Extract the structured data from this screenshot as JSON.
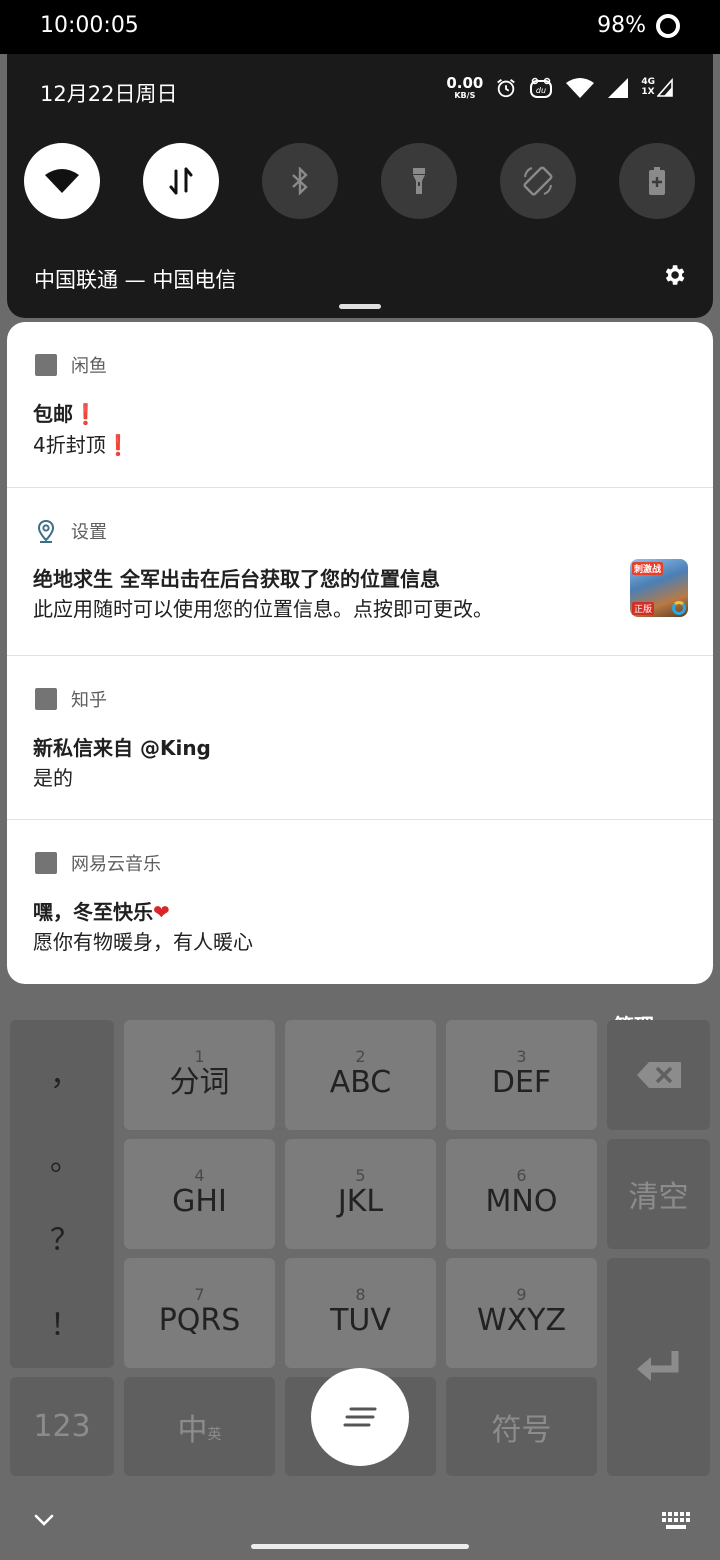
{
  "status_bar": {
    "time": "10:00:05",
    "battery": "98%"
  },
  "quick_settings": {
    "date": "12月22日周日",
    "speed_value": "0.00",
    "speed_unit": "KB/S",
    "net_type": "4G",
    "net_sub": "1X",
    "carrier": "中国联通 — 中国电信",
    "tiles": [
      {
        "name": "wifi",
        "active": true
      },
      {
        "name": "mobile-data",
        "active": true
      },
      {
        "name": "bluetooth",
        "active": false
      },
      {
        "name": "flashlight",
        "active": false
      },
      {
        "name": "auto-rotate",
        "active": false
      },
      {
        "name": "battery-saver",
        "active": false
      }
    ]
  },
  "notifications": [
    {
      "app": "闲鱼",
      "title": "包邮",
      "body": "4折封顶",
      "title_suffix": "❗",
      "body_suffix": "❗"
    },
    {
      "app": "设置",
      "title": "绝地求生 全军出击在后台获取了您的位置信息",
      "body": "此应用随时可以使用您的位置信息。点按即可更改。",
      "thumb_tag": "刺激战",
      "thumb_badge": "正版"
    },
    {
      "app": "知乎",
      "title": "新私信来自 @King",
      "body": "是的"
    },
    {
      "app": "网易云音乐",
      "title": "嘿，冬至快乐",
      "title_suffix": "❤",
      "body": "愿你有物暖身，有人暖心"
    }
  ],
  "keyboard": {
    "manage": "管理",
    "punctuation": [
      "，",
      "。",
      "？",
      "！"
    ],
    "keys": [
      {
        "num": "1",
        "label": "分词"
      },
      {
        "num": "2",
        "label": "ABC"
      },
      {
        "num": "3",
        "label": "DEF"
      },
      {
        "num": "4",
        "label": "GHI"
      },
      {
        "num": "5",
        "label": "JKL"
      },
      {
        "num": "6",
        "label": "MNO"
      },
      {
        "num": "7",
        "label": "PQRS"
      },
      {
        "num": "8",
        "label": "TUV"
      },
      {
        "num": "9",
        "label": "WXYZ"
      }
    ],
    "clear": "清空",
    "num_mode": "123",
    "lang_mode": "中",
    "lang_sub": "英",
    "symbols": "符号"
  }
}
